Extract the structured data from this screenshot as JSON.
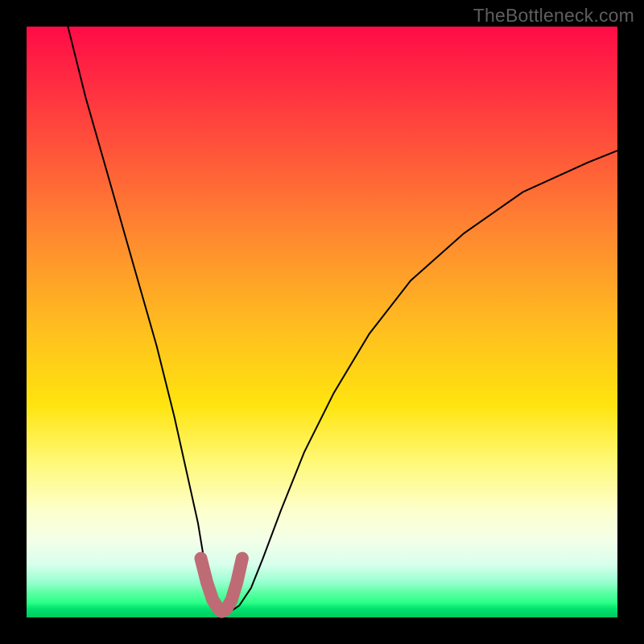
{
  "watermark": "TheBottleneck.com",
  "chart_data": {
    "type": "line",
    "title": "",
    "xlabel": "",
    "ylabel": "",
    "xlim": [
      0,
      100
    ],
    "ylim": [
      0,
      100
    ],
    "series": [
      {
        "name": "main-curve",
        "x": [
          7,
          10,
          14,
          18,
          22,
          25,
          27,
          29,
          30,
          31.5,
          33,
          34.5,
          36,
          38,
          40,
          43,
          47,
          52,
          58,
          65,
          74,
          84,
          95,
          100
        ],
        "y": [
          100,
          88,
          74,
          60,
          46,
          34,
          25,
          16,
          10,
          5,
          2,
          1,
          2,
          5,
          10,
          18,
          28,
          38,
          48,
          57,
          65,
          72,
          77,
          79
        ]
      },
      {
        "name": "trough-overlay",
        "x": [
          29.5,
          30.5,
          31.5,
          32.5,
          33,
          33.8,
          34.7,
          35.6,
          36.5
        ],
        "y": [
          10,
          6,
          3,
          1.4,
          1,
          1.4,
          3,
          6,
          10
        ]
      }
    ],
    "styles": {
      "main-curve": {
        "stroke": "#000000",
        "strokeWidth": 2,
        "fill": "none"
      },
      "trough-overlay": {
        "stroke": "#bf6b75",
        "strokeWidth": 16,
        "fill": "none",
        "linecap": "round",
        "linejoin": "round"
      }
    },
    "colors": {
      "frame": "#000000",
      "gradient_top": "#ff0b47",
      "gradient_bottom": "#00c95f"
    }
  }
}
